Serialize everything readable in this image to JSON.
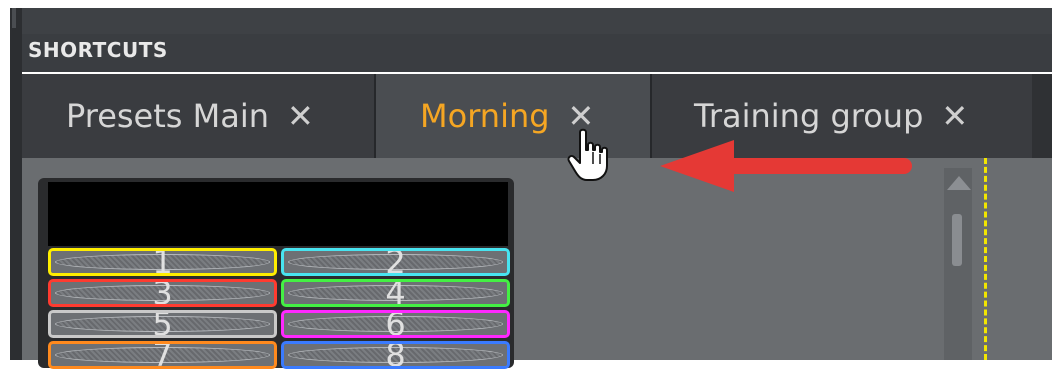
{
  "panel": {
    "title": "SHORTCUTS"
  },
  "tabs": [
    {
      "label": "Presets Main",
      "close": "✕",
      "active": false
    },
    {
      "label": "Morning",
      "close": "✕",
      "active": true
    },
    {
      "label": "Training group",
      "close": "✕",
      "active": false
    }
  ],
  "presets": [
    {
      "label": "1",
      "color": "#ffee00"
    },
    {
      "label": "2",
      "color": "#48e4f0"
    },
    {
      "label": "3",
      "color": "#ff3b30"
    },
    {
      "label": "4",
      "color": "#44f044"
    },
    {
      "label": "5",
      "color": "#c9c9c9"
    },
    {
      "label": "6",
      "color": "#ff28ff"
    },
    {
      "label": "7",
      "color": "#ff8a1e"
    },
    {
      "label": "8",
      "color": "#3a7bff"
    }
  ],
  "colors": {
    "active_tab_text": "#f5a623",
    "arrow": "#e53935",
    "dashed_line": "#f2e600"
  }
}
